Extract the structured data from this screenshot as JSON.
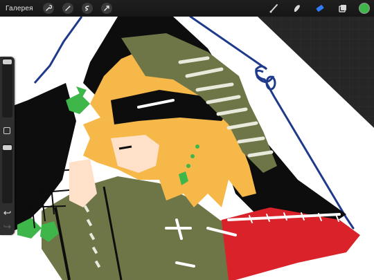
{
  "toolbar": {
    "gallery_label": "Галерея",
    "left_icons": [
      "wrench-icon",
      "magic-wand-icon",
      "selection-icon",
      "transform-arrow-icon"
    ],
    "right_tools": [
      "brush-icon",
      "smudge-icon",
      "eraser-icon",
      "layers-icon"
    ],
    "active_tool": "eraser-icon",
    "active_tool_color": "#2f7cf6",
    "current_color": "#3fb64a"
  },
  "sidebar": {
    "brush_size_level": 0.95,
    "opacity_level": 0.95,
    "modify_button": "square-icon",
    "undo": "undo-icon",
    "redo": "redo-icon"
  },
  "canvas": {
    "artwork_colors": {
      "paper": "#ffffff",
      "outline_blue": "#1f3a8a",
      "hair": "#f7b84a",
      "jacket": "#6e7547",
      "red": "#d9222a",
      "green": "#3fb64a",
      "black": "#0d0d0d",
      "skin": "#ffe0c8"
    }
  }
}
